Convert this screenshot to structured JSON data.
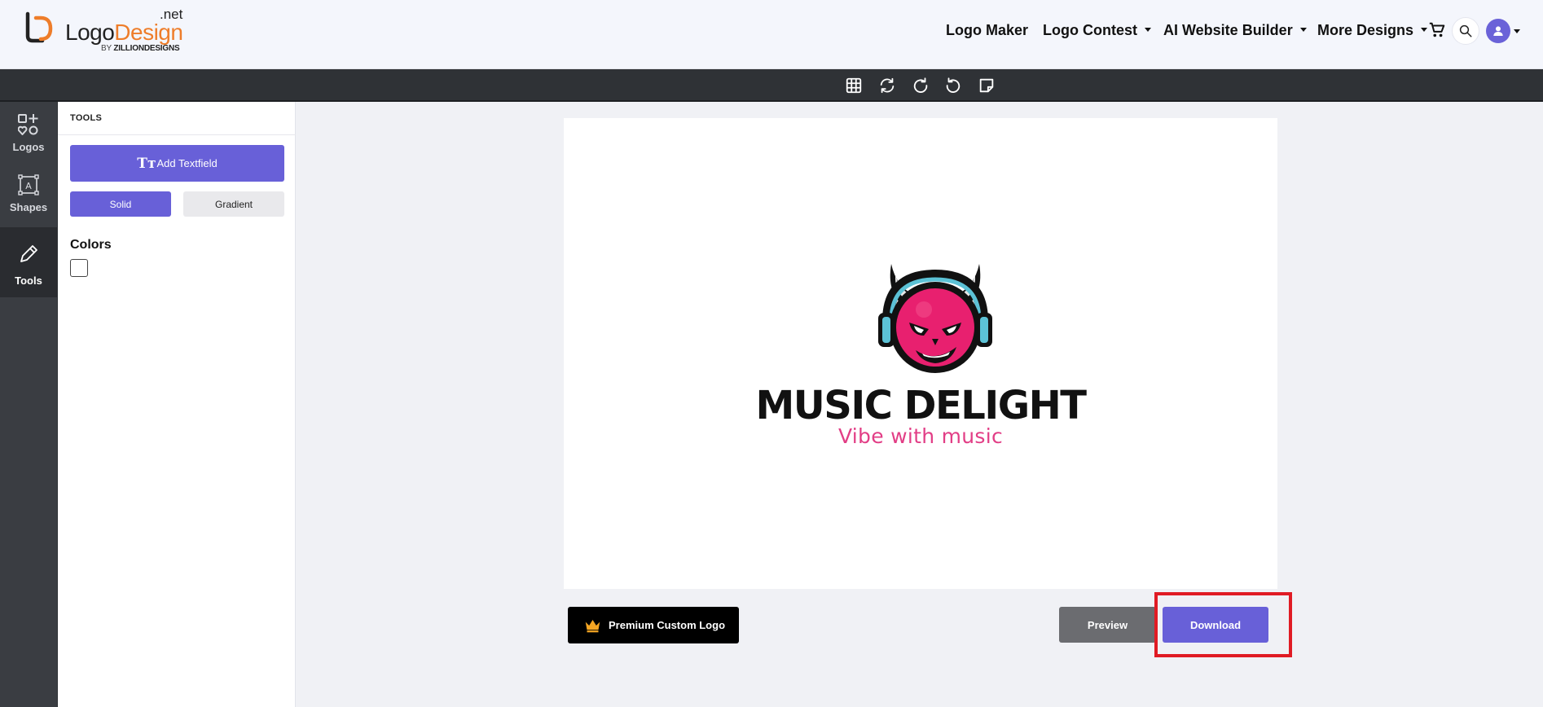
{
  "header": {
    "logo_word_1": "Logo",
    "logo_word_2": "Design",
    "logo_tld": ".net",
    "logo_by": "BY",
    "logo_by_brand": "ZILLIONDESIGNS",
    "nav": [
      {
        "label": "Logo Maker"
      },
      {
        "label": "Logo Contest"
      },
      {
        "label": "AI Website Builder"
      },
      {
        "label": "More Designs"
      }
    ],
    "icons": {
      "cart": "cart-icon",
      "search": "search-icon",
      "user": "user-icon"
    }
  },
  "toolbar": {
    "icons": [
      "grid-icon",
      "refresh-icon",
      "rotate-right-icon",
      "rotate-left-icon",
      "sticky-note-icon"
    ]
  },
  "rail": {
    "items": [
      {
        "label": "Logos",
        "icon": "logos-icon"
      },
      {
        "label": "Shapes",
        "icon": "shapes-icon"
      },
      {
        "label": "Tools",
        "icon": "pencil-icon",
        "active": true
      }
    ]
  },
  "panel": {
    "title": "TOOLS",
    "add_text_icon": "Tт",
    "add_text_label": "Add Textfield",
    "solid_label": "Solid",
    "gradient_label": "Gradient",
    "colors_label": "Colors"
  },
  "canvas": {
    "brand_name": "MUSIC DELIGHT",
    "slogan": "Vibe with music",
    "brand_color": "#111111",
    "slogan_color": "#e23e86"
  },
  "actions": {
    "premium_label": "Premium Custom Logo",
    "preview_label": "Preview",
    "download_label": "Download"
  },
  "colors": {
    "accent": "#6860d8",
    "highlight": "#e01b24"
  }
}
